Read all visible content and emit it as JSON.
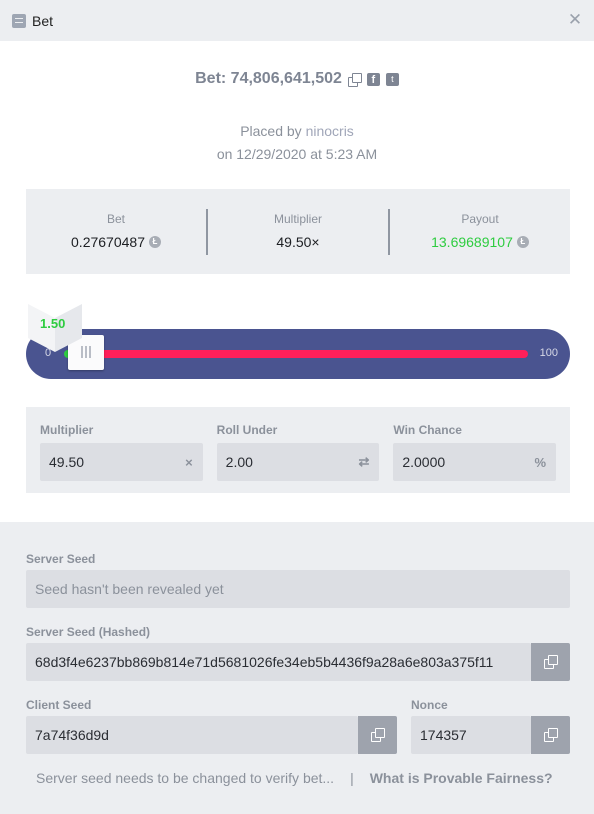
{
  "window": {
    "title": "Bet"
  },
  "bet_header": {
    "label": "Bet: 74,806,641,502"
  },
  "placed": {
    "prefix": "Placed by",
    "user": "ninocris",
    "datetime": "on 12/29/2020 at 5:23 AM"
  },
  "summary": {
    "bet": {
      "label": "Bet",
      "value": "0.27670487",
      "currency_icon": "litecoin-icon"
    },
    "multiplier": {
      "label": "Multiplier",
      "value": "49.50×"
    },
    "payout": {
      "label": "Payout",
      "value": "13.69689107",
      "currency_icon": "litecoin-icon",
      "color": "#2ecc40"
    }
  },
  "slider": {
    "min_label": "0",
    "max_label": "100",
    "roll_value": "1.50",
    "roll_fraction": 0.015,
    "threshold_fraction": 0.02,
    "win_color": "#2ecc40",
    "lose_color": "#ff1f5a",
    "track_color": "#4a5490"
  },
  "params": {
    "multiplier": {
      "label": "Multiplier",
      "value": "49.50",
      "icon": "×"
    },
    "roll_under": {
      "label": "Roll Under",
      "value": "2.00",
      "icon": "⇄"
    },
    "win_chance": {
      "label": "Win Chance",
      "value": "2.0000",
      "icon": "%"
    }
  },
  "fairness": {
    "server_seed": {
      "label": "Server Seed",
      "placeholder": "Seed hasn't been revealed yet"
    },
    "server_seed_hashed": {
      "label": "Server Seed (Hashed)",
      "value": "68d3f4e6237bb869b814e71d5681026fe34eb5b4436f9a28a6e803a375f11"
    },
    "client_seed": {
      "label": "Client Seed",
      "value": "7a74f36d9d"
    },
    "nonce": {
      "label": "Nonce",
      "value": "174357"
    },
    "note": "Server seed needs to be changed to verify bet...",
    "separator": "|",
    "link": "What is Provable Fairness?"
  }
}
